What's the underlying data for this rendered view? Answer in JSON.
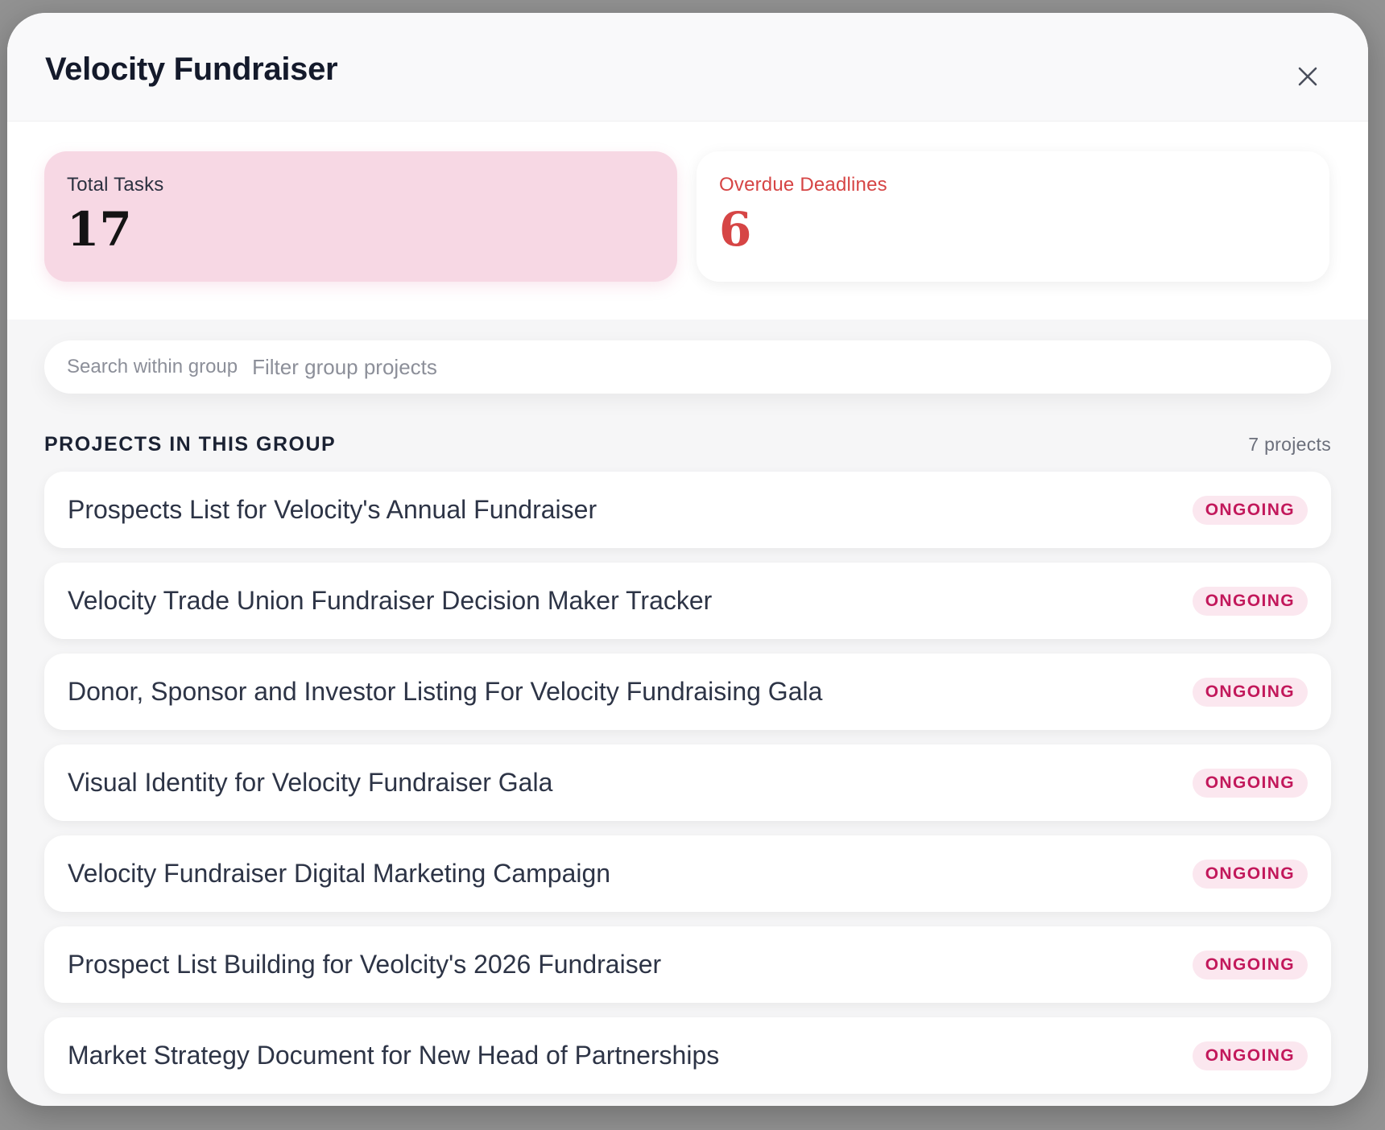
{
  "modal": {
    "title": "Velocity Fundraiser",
    "close_icon": "close-icon"
  },
  "stats": {
    "total": {
      "label": "Total Tasks",
      "value": "17"
    },
    "overdue": {
      "label": "Overdue Deadlines",
      "value": "6"
    }
  },
  "search": {
    "label": "Search within group",
    "placeholder": "Filter group projects",
    "value": ""
  },
  "projects_section": {
    "title": "PROJECTS IN THIS GROUP",
    "count": "7 projects",
    "items": [
      {
        "name": "Prospects List for Velocity's Annual Fundraiser",
        "status": "ONGOING"
      },
      {
        "name": "Velocity Trade Union Fundraiser Decision Maker Tracker",
        "status": "ONGOING"
      },
      {
        "name": "Donor, Sponsor and Investor Listing For Velocity Fundraising Gala",
        "status": "ONGOING"
      },
      {
        "name": "Visual Identity for Velocity Fundraiser Gala",
        "status": "ONGOING"
      },
      {
        "name": "Velocity Fundraiser Digital Marketing Campaign",
        "status": "ONGOING"
      },
      {
        "name": "Prospect List Building for Veolcity's 2026 Fundraiser",
        "status": "ONGOING"
      },
      {
        "name": "Market Strategy Document for New Head of Partnerships",
        "status": "ONGOING"
      }
    ]
  },
  "colors": {
    "total_card_bg": "#f7d8e4",
    "overdue_accent": "#d64545",
    "badge_bg": "#fbe7ef",
    "badge_text": "#c2185b"
  }
}
